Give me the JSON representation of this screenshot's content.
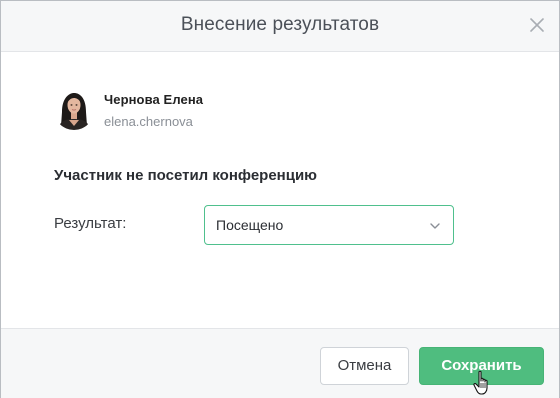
{
  "dialog": {
    "title": "Внесение результатов",
    "close_icon": "close-icon"
  },
  "user": {
    "name": "Чернова Елена",
    "login": "elena.chernova",
    "avatar_icon": "avatar-photo"
  },
  "notice": "Участник не посетил конференцию",
  "result": {
    "label": "Результат:",
    "selected": "Посещено",
    "chevron_icon": "chevron-down-icon"
  },
  "footer": {
    "cancel_label": "Отмена",
    "save_label": "Сохранить"
  },
  "colors": {
    "accent": "#4fbd7f",
    "select_border": "#4fc08d",
    "header_bg": "#f6f7f8"
  }
}
